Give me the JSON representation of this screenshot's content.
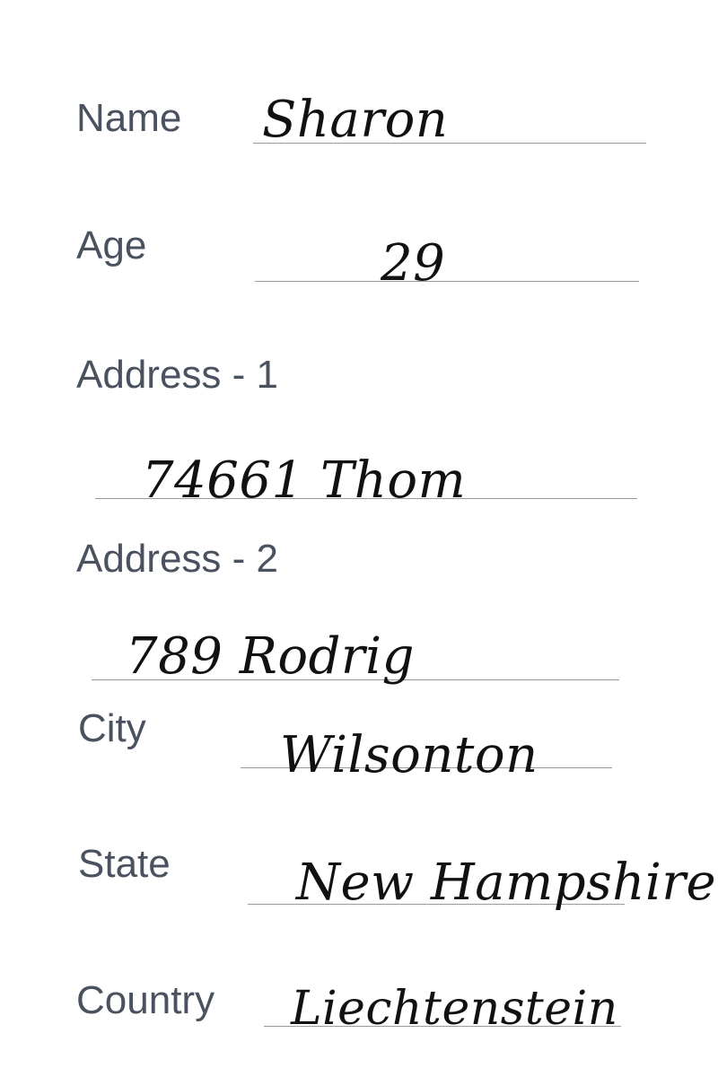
{
  "form": {
    "name": {
      "label": "Name",
      "value": "Sharon"
    },
    "age": {
      "label": "Age",
      "value": "29"
    },
    "address1": {
      "label": "Address - 1",
      "value": "74661 Thom"
    },
    "address2": {
      "label": "Address - 2",
      "value": "789 Rodrig"
    },
    "city": {
      "label": "City",
      "value": "Wilsonton"
    },
    "state": {
      "label": "State",
      "value": "New Hampshire"
    },
    "country": {
      "label": "Country",
      "value": "Liechtenstein"
    }
  },
  "colors": {
    "label_text": "#4a5260",
    "handwriting": "#111111",
    "rule_line": "#9a9a9a"
  }
}
